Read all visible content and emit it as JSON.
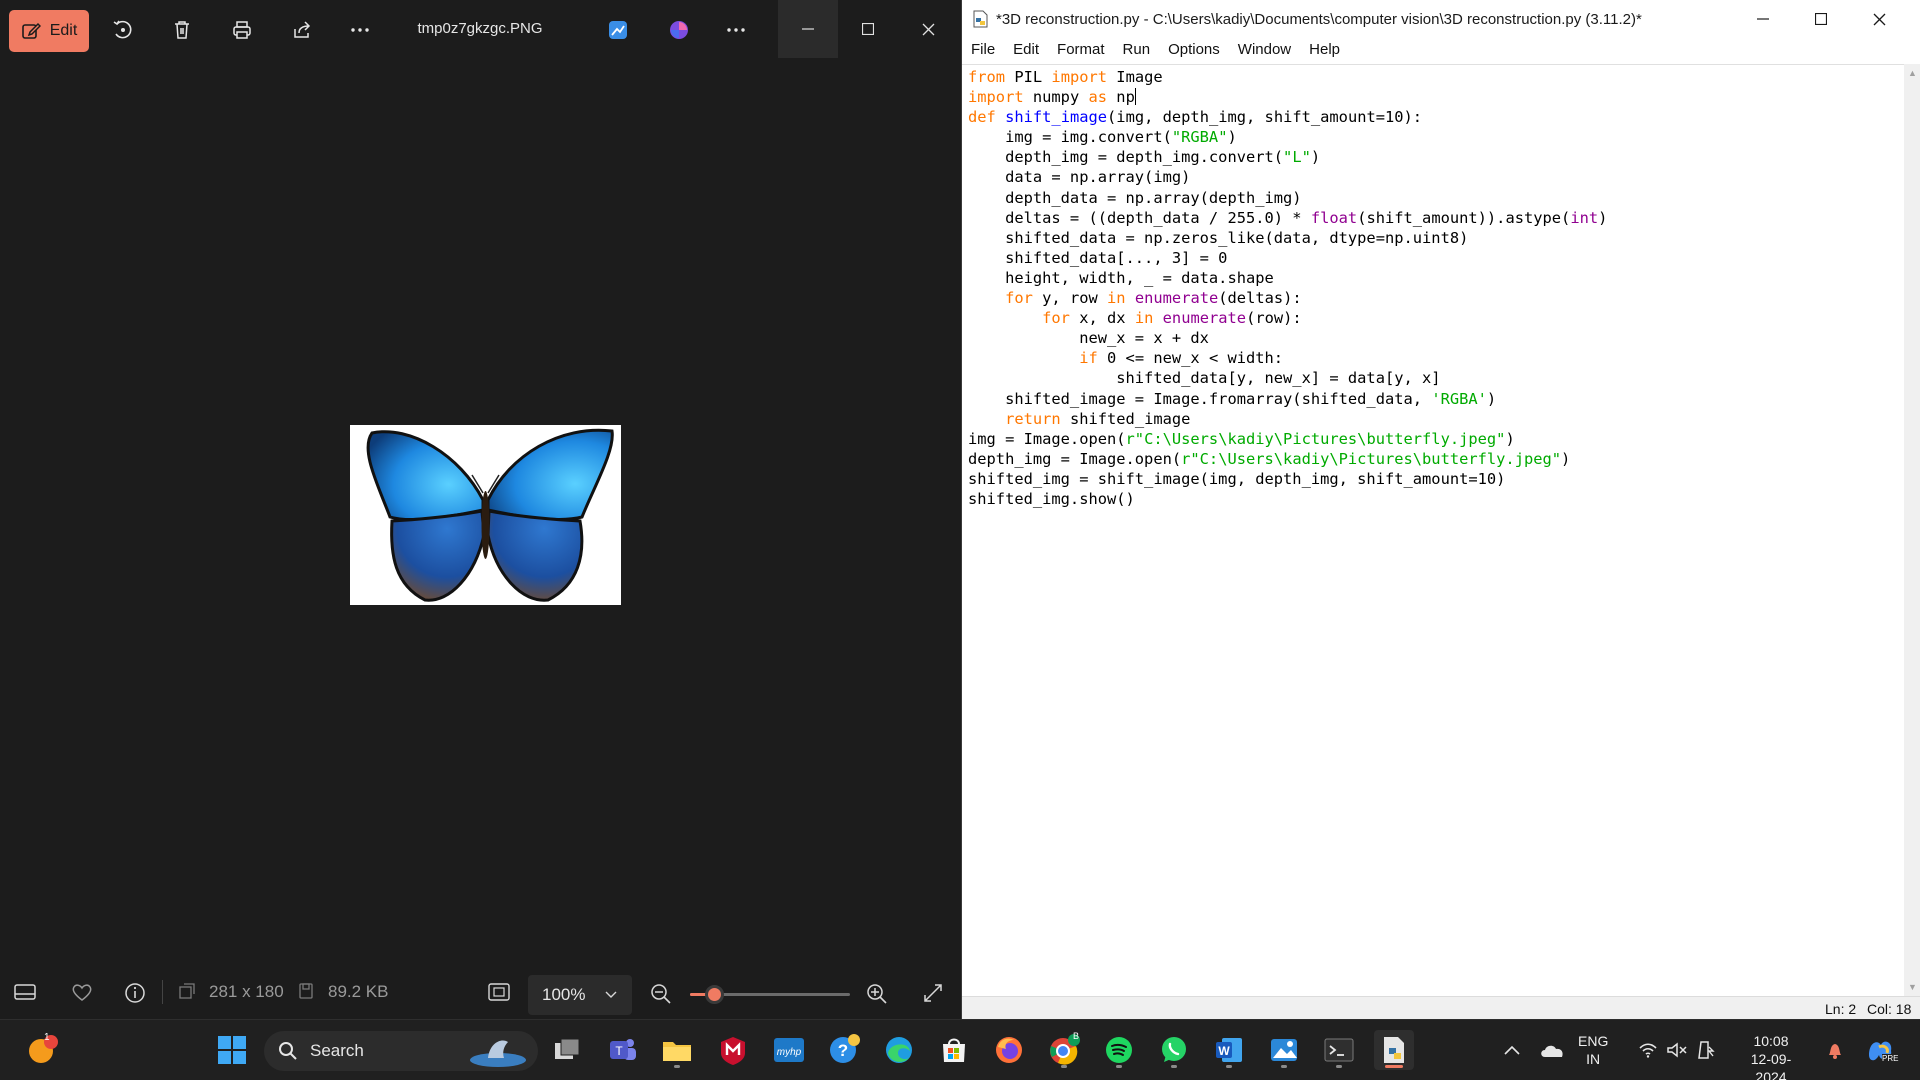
{
  "photos": {
    "toolbar": {
      "edit_label": "Edit",
      "file_name": "tmp0z7gkzgc.PNG",
      "icons": [
        "edit-icon",
        "rotate-icon",
        "delete-icon",
        "print-icon",
        "share-icon",
        "more-icon",
        "designer-icon",
        "clipchamp-icon",
        "more-icon"
      ]
    },
    "status": {
      "dimensions": "281 x 180",
      "file_size": "89.2 KB",
      "zoom": "100%",
      "zoom_fraction": 0.12
    }
  },
  "idle": {
    "title": "*3D reconstruction.py - C:\\Users\\kadiy\\Documents\\computer vision\\3D reconstruction.py (3.11.2)*",
    "menu": [
      "File",
      "Edit",
      "Format",
      "Run",
      "Options",
      "Window",
      "Help"
    ],
    "code_lines": [
      "from PIL import Image",
      "import numpy as np",
      "def shift_image(img, depth_img, shift_amount=10):",
      "    img = img.convert(\"RGBA\")",
      "    depth_img = depth_img.convert(\"L\")",
      "    data = np.array(img)",
      "    depth_data = np.array(depth_img)",
      "    deltas = ((depth_data / 255.0) * float(shift_amount)).astype(int)",
      "    shifted_data = np.zeros_like(data, dtype=np.uint8)",
      "    shifted_data[..., 3] = 0",
      "    height, width, _ = data.shape",
      "    for y, row in enumerate(deltas):",
      "        for x, dx in enumerate(row):",
      "            new_x = x + dx",
      "            if 0 <= new_x < width:",
      "                shifted_data[y, new_x] = data[y, x]",
      "    shifted_image = Image.fromarray(shifted_data, 'RGBA')",
      "    return shifted_image",
      "img = Image.open(r\"C:\\Users\\kadiy\\Pictures\\butterfly.jpeg\")",
      "depth_img = Image.open(r\"C:\\Users\\kadiy\\Pictures\\butterfly.jpeg\")",
      "shifted_img = shift_image(img, depth_img, shift_amount=10)",
      "shifted_img.show()"
    ],
    "status": {
      "line": "Ln: 2",
      "col": "Col: 18"
    }
  },
  "taskbar": {
    "search_placeholder": "Search",
    "notification_badge": "1",
    "chrome_badge": "B",
    "lang_line1": "ENG",
    "lang_line2": "IN",
    "time": "10:08",
    "date": "12-09-2024",
    "copilot_badge": "PRE"
  },
  "colors": {
    "accent": "#f07b62",
    "keyword": "#ff7700",
    "builtin": "#900090",
    "string": "#00aa00",
    "definition": "#0000ff"
  }
}
